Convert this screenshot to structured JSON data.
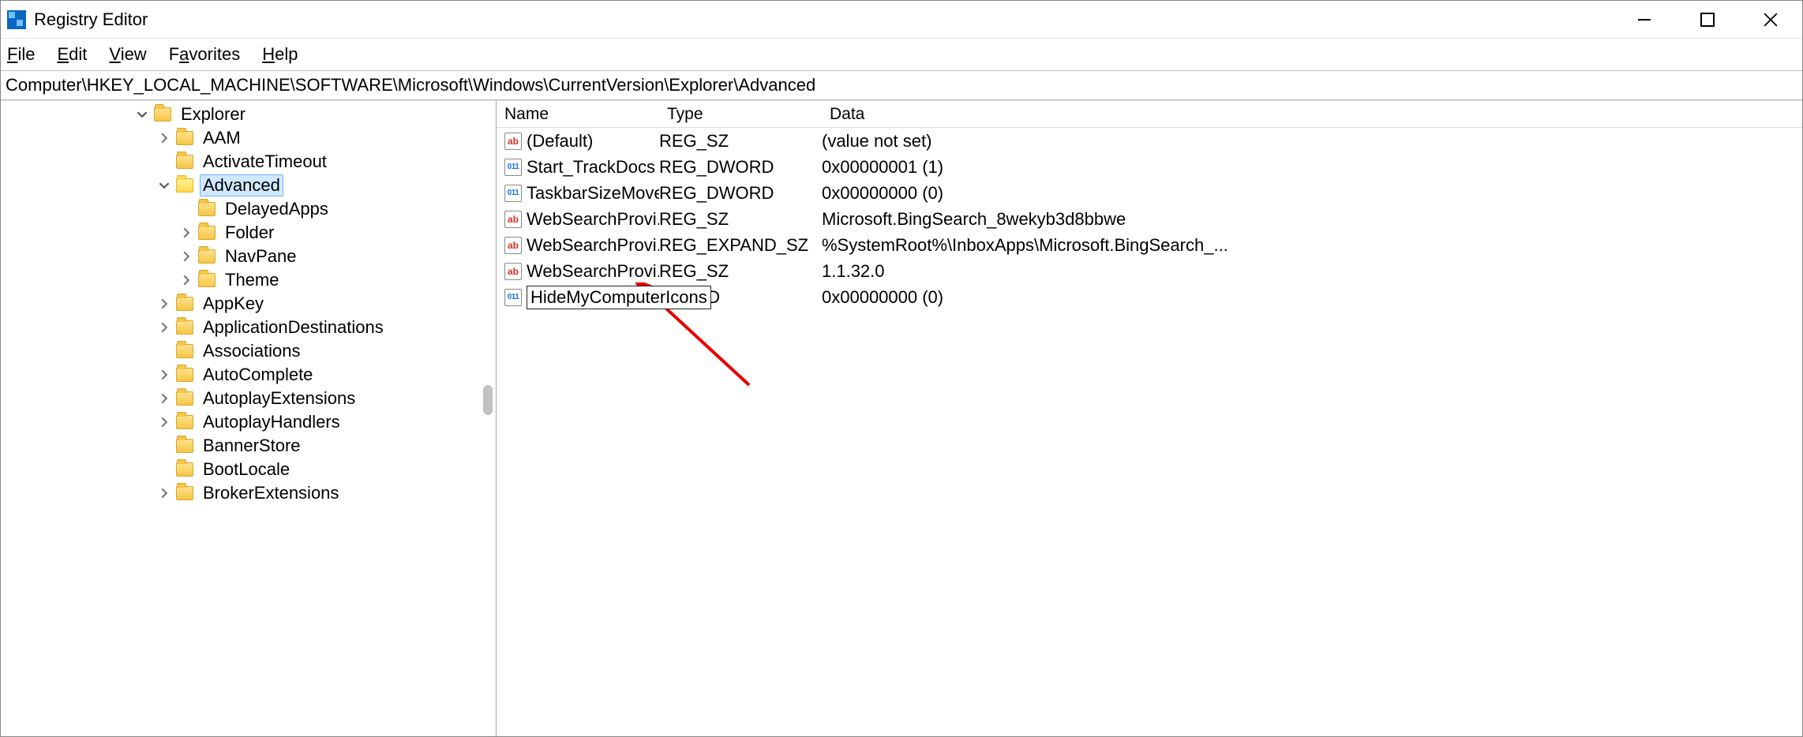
{
  "window": {
    "title": "Registry Editor"
  },
  "menu": {
    "file": "File",
    "edit": "Edit",
    "view": "View",
    "favorites": "Favorites",
    "help": "Help",
    "file_u": "F",
    "edit_u": "E",
    "view_u": "V",
    "favorites_u": "a",
    "help_u": "H"
  },
  "address": "Computer\\HKEY_LOCAL_MACHINE\\SOFTWARE\\Microsoft\\Windows\\CurrentVersion\\Explorer\\Advanced",
  "tree": [
    {
      "indent": 168,
      "expander": "down",
      "label": "Explorer",
      "selected": false
    },
    {
      "indent": 196,
      "expander": "right",
      "label": "AAM",
      "selected": false
    },
    {
      "indent": 196,
      "expander": "none",
      "label": "ActivateTimeout",
      "selected": false
    },
    {
      "indent": 196,
      "expander": "down",
      "label": "Advanced",
      "selected": true
    },
    {
      "indent": 224,
      "expander": "none",
      "label": "DelayedApps",
      "selected": false
    },
    {
      "indent": 224,
      "expander": "right",
      "label": "Folder",
      "selected": false
    },
    {
      "indent": 224,
      "expander": "right",
      "label": "NavPane",
      "selected": false
    },
    {
      "indent": 224,
      "expander": "right",
      "label": "Theme",
      "selected": false
    },
    {
      "indent": 196,
      "expander": "right",
      "label": "AppKey",
      "selected": false
    },
    {
      "indent": 196,
      "expander": "right",
      "label": "ApplicationDestinations",
      "selected": false
    },
    {
      "indent": 196,
      "expander": "none",
      "label": "Associations",
      "selected": false
    },
    {
      "indent": 196,
      "expander": "right",
      "label": "AutoComplete",
      "selected": false
    },
    {
      "indent": 196,
      "expander": "right",
      "label": "AutoplayExtensions",
      "selected": false
    },
    {
      "indent": 196,
      "expander": "right",
      "label": "AutoplayHandlers",
      "selected": false
    },
    {
      "indent": 196,
      "expander": "none",
      "label": "BannerStore",
      "selected": false
    },
    {
      "indent": 196,
      "expander": "none",
      "label": "BootLocale",
      "selected": false
    },
    {
      "indent": 196,
      "expander": "right",
      "label": "BrokerExtensions",
      "selected": false
    }
  ],
  "columns": {
    "name": "Name",
    "type": "Type",
    "data": "Data"
  },
  "values": [
    {
      "icon": "sz",
      "name": "(Default)",
      "type": "REG_SZ",
      "data": "(value not set)",
      "editing": false
    },
    {
      "icon": "dw",
      "name": "Start_TrackDocs",
      "type": "REG_DWORD",
      "data": "0x00000001 (1)",
      "editing": false
    },
    {
      "icon": "dw",
      "name": "TaskbarSizeMove",
      "type": "REG_DWORD",
      "data": "0x00000000 (0)",
      "editing": false
    },
    {
      "icon": "sz",
      "name": "WebSearchProvi...",
      "type": "REG_SZ",
      "data": "Microsoft.BingSearch_8wekyb3d8bbwe",
      "editing": false
    },
    {
      "icon": "sz",
      "name": "WebSearchProvi...",
      "type": "REG_EXPAND_SZ",
      "data": "%SystemRoot%\\InboxApps\\Microsoft.BingSearch_...",
      "editing": false
    },
    {
      "icon": "sz",
      "name": "WebSearchProvi...",
      "type": "REG_SZ",
      "data": "1.1.32.0",
      "editing": false
    },
    {
      "icon": "dw",
      "name": "HideMyComputerIcons",
      "type": "DWORD",
      "type_visible": ")WORD",
      "data": "0x00000000 (0)",
      "editing": true
    }
  ],
  "annotation": {
    "color": "#e60000"
  }
}
